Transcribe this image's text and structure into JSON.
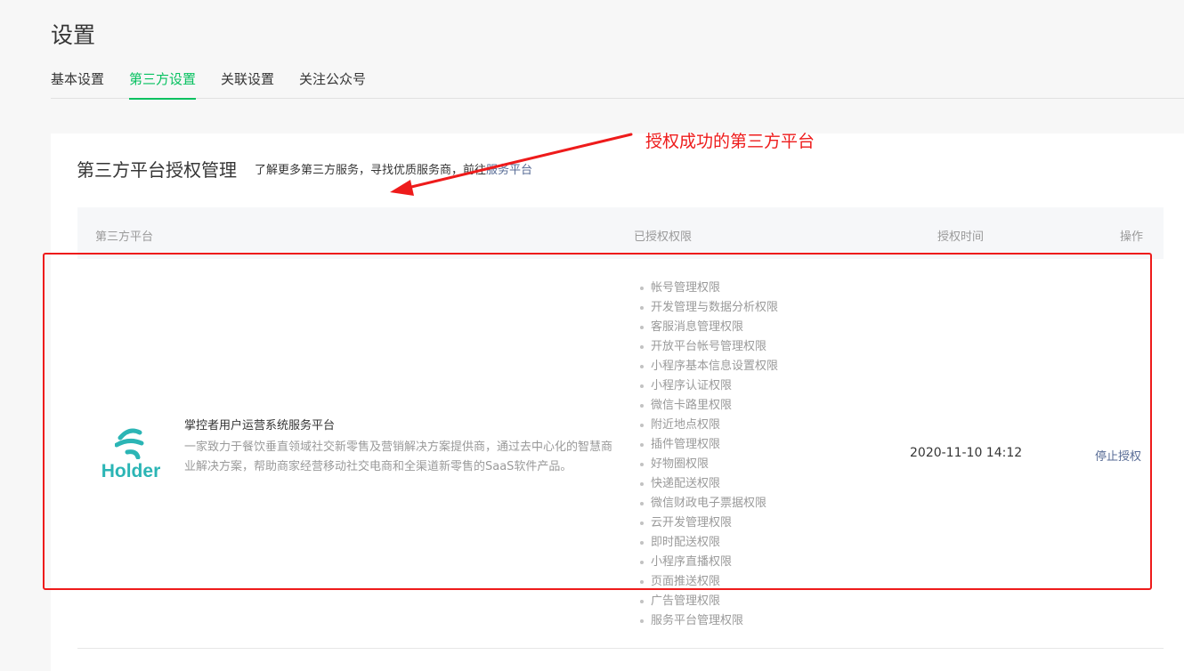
{
  "page": {
    "title": "设置"
  },
  "tabs": [
    {
      "label": "基本设置",
      "active": false
    },
    {
      "label": "第三方设置",
      "active": true
    },
    {
      "label": "关联设置",
      "active": false
    },
    {
      "label": "关注公众号",
      "active": false
    }
  ],
  "card": {
    "title": "第三方平台授权管理",
    "desc_prefix": "了解更多第三方服务，寻找优质服务商，前往",
    "desc_link": "服务平台"
  },
  "table": {
    "headers": [
      "第三方平台",
      "已授权权限",
      "授权时间",
      "操作"
    ],
    "row": {
      "logo_text": "Holder",
      "logo_icon": "holder-logo-icon",
      "name": "掌控者用户运营系统服务平台",
      "description": "一家致力于餐饮垂直领域社交新零售及营销解决方案提供商，通过去中心化的智慧商业解决方案，帮助商家经营移动社交电商和全渠道新零售的SaaS软件产品。",
      "permissions": [
        "帐号管理权限",
        "开发管理与数据分析权限",
        "客服消息管理权限",
        "开放平台帐号管理权限",
        "小程序基本信息设置权限",
        "小程序认证权限",
        "微信卡路里权限",
        "附近地点权限",
        "插件管理权限",
        "好物圈权限",
        "快递配送权限",
        "微信财政电子票据权限",
        "云开发管理权限",
        "即时配送权限",
        "小程序直播权限",
        "页面推送权限",
        "广告管理权限",
        "服务平台管理权限"
      ],
      "auth_time": "2020-11-10 14:12",
      "action": "停止授权"
    }
  },
  "annotation": {
    "text": "授权成功的第三方平台",
    "color": "#ee1b1b"
  },
  "colors": {
    "accent": "#07c160",
    "link": "#576b95",
    "annotation": "#ee1b1b",
    "logo": "#2bb5b5"
  }
}
